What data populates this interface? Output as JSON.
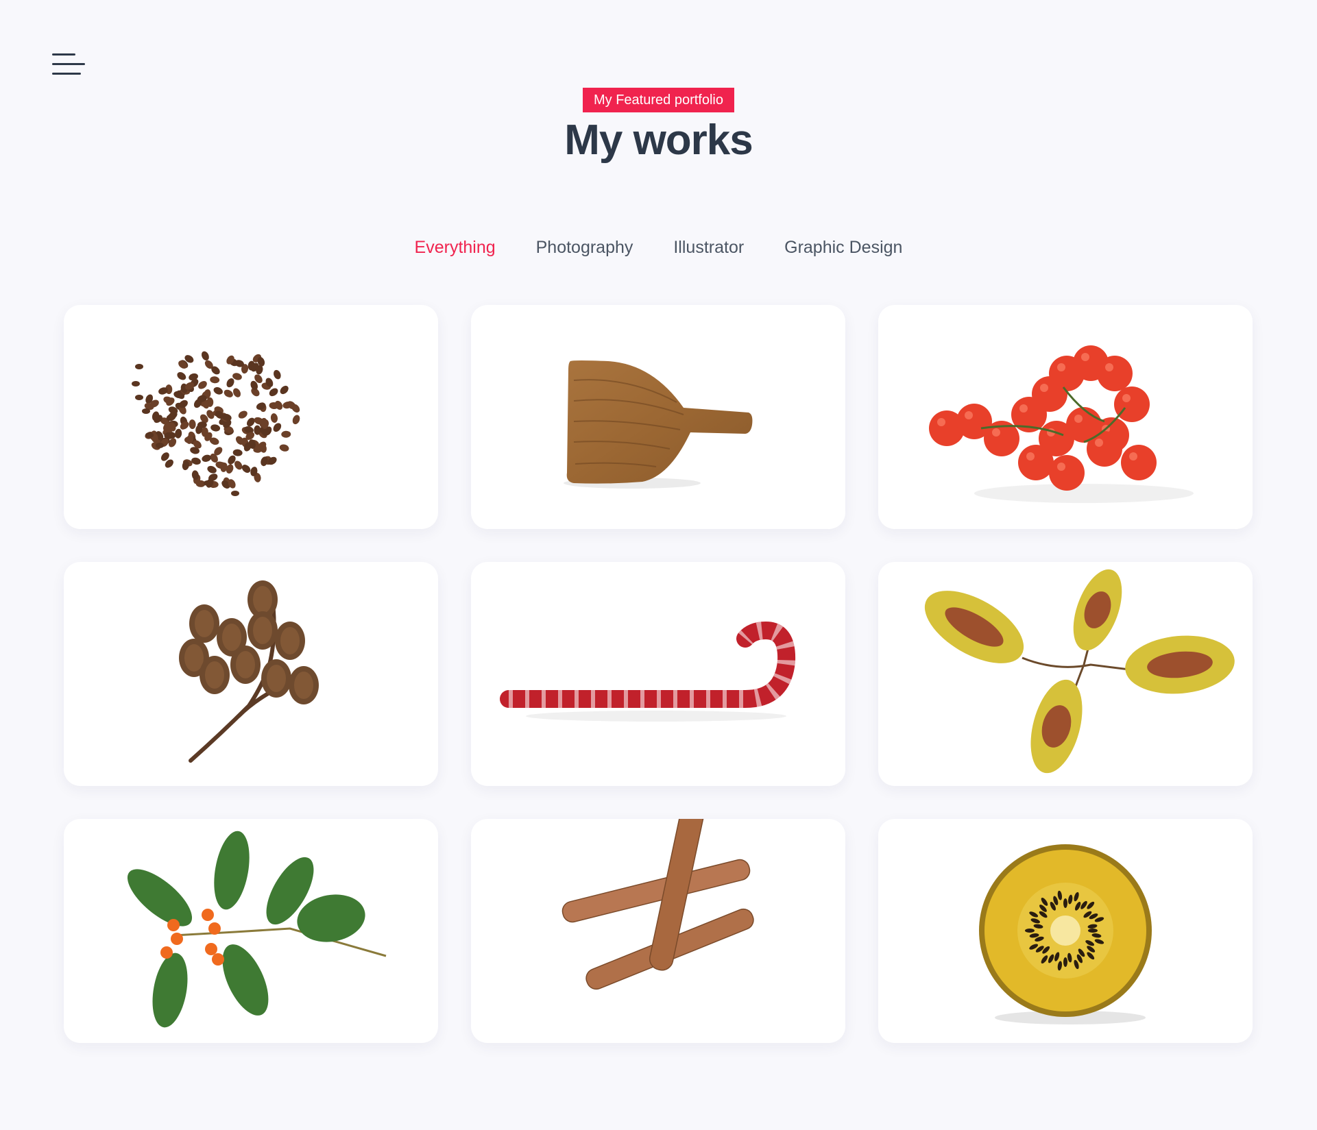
{
  "menu": {
    "icon": "hamburger-menu-icon"
  },
  "header": {
    "badge": "My Featured portfolio",
    "title": "My works"
  },
  "filters": {
    "items": [
      "Everything",
      "Photography",
      "Illustrator",
      "Graphic Design"
    ],
    "active": "Everything"
  },
  "portfolio": {
    "items": [
      {
        "subject": "coffee-beans"
      },
      {
        "subject": "wooden-cutting-board"
      },
      {
        "subject": "cherry-tomatoes"
      },
      {
        "subject": "alder-cones"
      },
      {
        "subject": "candy-cane"
      },
      {
        "subject": "coleus-leaves"
      },
      {
        "subject": "berry-branch"
      },
      {
        "subject": "cinnamon-sticks"
      },
      {
        "subject": "golden-kiwi-slice"
      }
    ]
  },
  "colors": {
    "accent": "#f0234e",
    "heading": "#2d3848",
    "background": "#f8f8fc"
  }
}
